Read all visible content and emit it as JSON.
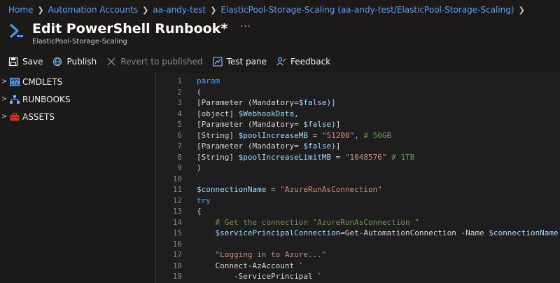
{
  "breadcrumb": [
    "Home",
    "Automation Accounts",
    "aa-andy-test",
    "ElasticPool-Storage-Scaling (aa-andy-test/ElasticPool-Storage-Scaling)"
  ],
  "header": {
    "title": "Edit PowerShell Runbook*",
    "subtitle": "ElasticPool-Storage-Scaling",
    "more": "···"
  },
  "toolbar": {
    "save": "Save",
    "publish": "Publish",
    "revert": "Revert to published",
    "test_pane": "Test pane",
    "feedback": "Feedback"
  },
  "tree": {
    "cmdlets": "CMDLETS",
    "runbooks": "RUNBOOKS",
    "assets": "ASSETS"
  },
  "colors": {
    "background": "#1b1a19",
    "editor_bg": "#1e1e1e",
    "link": "#4fa3ff",
    "keyword": "#569cd6",
    "variable": "#9cdcfe",
    "string": "#ce9178",
    "comment": "#6a9955"
  },
  "editor": {
    "lines": [
      {
        "n": "1",
        "tokens": [
          [
            "kw",
            "param"
          ]
        ]
      },
      {
        "n": "2",
        "tokens": [
          [
            "txt",
            "("
          ]
        ]
      },
      {
        "n": "3",
        "tokens": [
          [
            "txt",
            "[Parameter (Mandatory="
          ],
          [
            "var",
            "$false"
          ],
          [
            "txt",
            ")]"
          ]
        ]
      },
      {
        "n": "4",
        "tokens": [
          [
            "txt",
            "[object] "
          ],
          [
            "var",
            "$WebhookData"
          ],
          [
            "txt",
            ","
          ]
        ]
      },
      {
        "n": "5",
        "tokens": [
          [
            "txt",
            "[Parameter (Mandatory= "
          ],
          [
            "var",
            "$false"
          ],
          [
            "txt",
            ")]"
          ]
        ]
      },
      {
        "n": "6",
        "tokens": [
          [
            "txt",
            "[String] "
          ],
          [
            "var",
            "$poolIncreaseMB"
          ],
          [
            "txt",
            " = "
          ],
          [
            "str",
            "\"51200\""
          ],
          [
            "txt",
            ", "
          ],
          [
            "cmt",
            "# 50GB"
          ]
        ]
      },
      {
        "n": "7",
        "tokens": [
          [
            "txt",
            "[Parameter (Mandatory= "
          ],
          [
            "var",
            "$false"
          ],
          [
            "txt",
            ")]"
          ]
        ]
      },
      {
        "n": "8",
        "tokens": [
          [
            "txt",
            "[String] "
          ],
          [
            "var",
            "$poolIncreaseLimitMB"
          ],
          [
            "txt",
            " = "
          ],
          [
            "str",
            "\"1048576\""
          ],
          [
            "txt",
            " "
          ],
          [
            "cmt",
            "# 1TB"
          ]
        ]
      },
      {
        "n": "9",
        "tokens": [
          [
            "txt",
            ")"
          ]
        ]
      },
      {
        "n": "10",
        "tokens": []
      },
      {
        "n": "11",
        "tokens": [
          [
            "var",
            "$connectionName"
          ],
          [
            "txt",
            " = "
          ],
          [
            "str",
            "\"AzureRunAsConnection\""
          ]
        ]
      },
      {
        "n": "12",
        "tokens": [
          [
            "kw",
            "try"
          ]
        ]
      },
      {
        "n": "13",
        "tokens": [
          [
            "txt",
            "{"
          ]
        ]
      },
      {
        "n": "14",
        "tokens": [
          [
            "txt",
            "    "
          ],
          [
            "cmt",
            "# Get the connection \"AzureRunAsConnection \""
          ]
        ]
      },
      {
        "n": "15",
        "tokens": [
          [
            "txt",
            "    "
          ],
          [
            "var",
            "$servicePrincipalConnection"
          ],
          [
            "txt",
            "=Get-AutomationConnection -Name "
          ],
          [
            "var",
            "$connectionName"
          ]
        ]
      },
      {
        "n": "16",
        "tokens": []
      },
      {
        "n": "17",
        "tokens": [
          [
            "txt",
            "    "
          ],
          [
            "str",
            "\"Logging in to Azure...\""
          ]
        ]
      },
      {
        "n": "18",
        "tokens": [
          [
            "txt",
            "    Connect-AzAccount `"
          ]
        ]
      },
      {
        "n": "19",
        "tokens": [
          [
            "txt",
            "        -ServicePrincipal `"
          ]
        ]
      }
    ]
  }
}
